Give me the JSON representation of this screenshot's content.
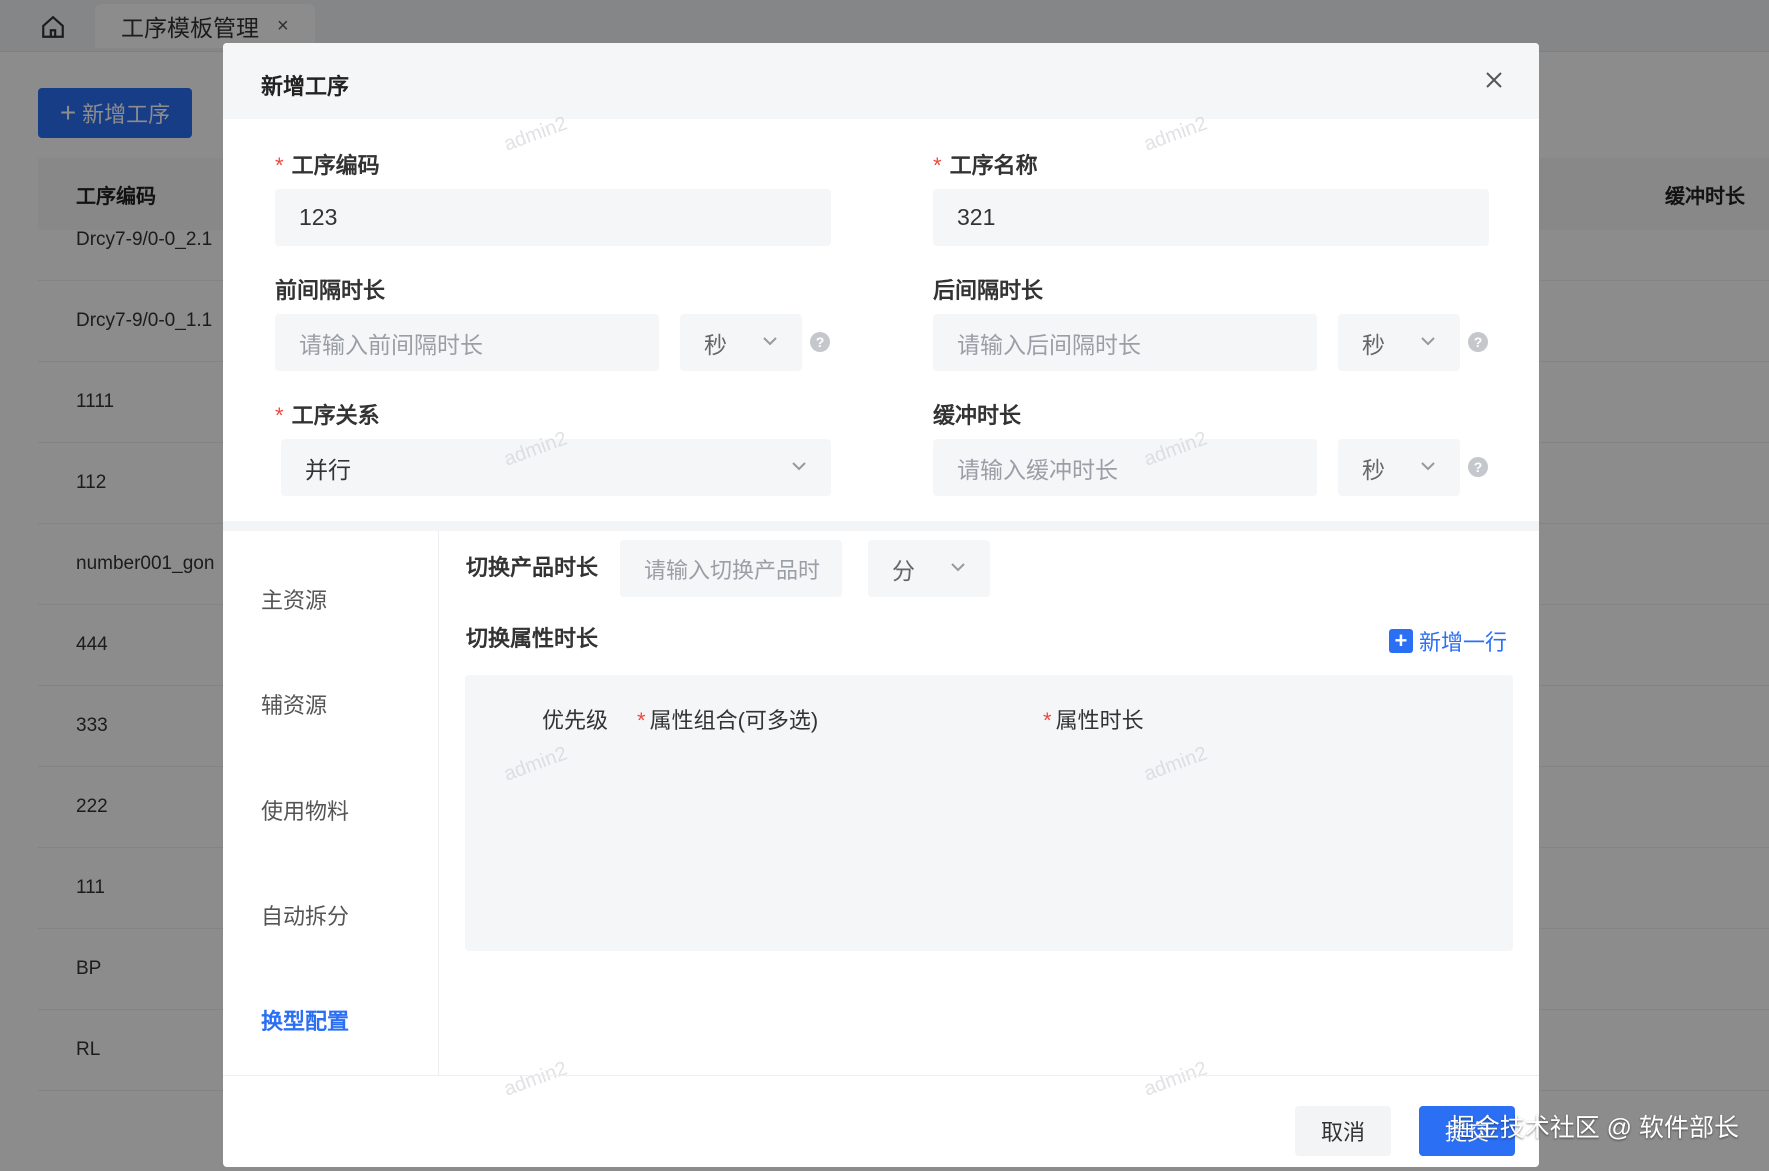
{
  "background": {
    "home_icon": "home-icon",
    "tab_label": "工序模板管理",
    "tab_close": "×",
    "add_button": {
      "icon": "plus-icon",
      "label": "新增工序"
    },
    "table": {
      "col_code": "工序编码",
      "col_buffer": "缓冲时长",
      "rows": [
        "Drcy7-9/0-0_2.1",
        "Drcy7-9/0-0_1.1",
        "1111",
        "112",
        "number001_gon",
        "444",
        "333",
        "222",
        "111",
        "BP",
        "RL"
      ]
    }
  },
  "modal": {
    "title": "新增工序",
    "close_icon": "close-icon",
    "fields": {
      "code": {
        "label": "工序编码",
        "required": "*",
        "value": "123"
      },
      "name": {
        "label": "工序名称",
        "required": "*",
        "value": "321"
      },
      "pre_interval": {
        "label": "前间隔时长",
        "placeholder": "请输入前间隔时长",
        "unit": "秒"
      },
      "post_interval": {
        "label": "后间隔时长",
        "placeholder": "请输入后间隔时长",
        "unit": "秒"
      },
      "relation": {
        "label": "工序关系",
        "required": "*",
        "value": "并行"
      },
      "buffer": {
        "label": "缓冲时长",
        "placeholder": "请输入缓冲时长",
        "unit": "秒"
      },
      "help_mark": "?"
    },
    "side_nav": {
      "items": [
        "主资源",
        "辅资源",
        "使用物料",
        "自动拆分",
        "换型配置"
      ],
      "active": "换型配置"
    },
    "changeover": {
      "product_switch_label": "切换产品时长",
      "product_switch_placeholder": "请输入切换产品时",
      "product_switch_unit": "分",
      "attr_switch_label": "切换属性时长",
      "add_row_label": "新增一行",
      "add_row_icon": "+",
      "table_headers": {
        "priority": "优先级",
        "attr_combo": "属性组合(可多选)",
        "attr_duration": "属性时长",
        "required": "*"
      }
    },
    "footer": {
      "cancel": "取消",
      "submit": "提交"
    },
    "watermark": "admin2"
  },
  "credit": "掘金技术社区 @ 软件部长",
  "colors": {
    "primary": "#2b6ff5",
    "required": "#f0483e",
    "input_bg": "#f5f6f8"
  }
}
